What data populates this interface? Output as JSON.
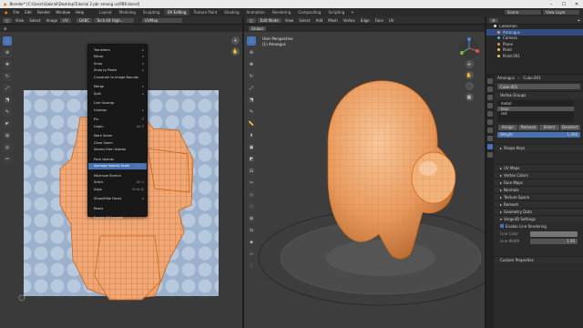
{
  "window": {
    "title": "Blender* [C:\\Users\\Gabriel\\Desktop\\Tutorial 2 pbr among us\\PBR.blend]",
    "controls": [
      "–",
      "☐",
      "✕"
    ]
  },
  "menubar": {
    "menus": [
      "File",
      "Edit",
      "Render",
      "Window",
      "Help"
    ],
    "workspaces": [
      "Layout",
      "Modeling",
      "Sculpting",
      "UV Editing",
      "Texture Paint",
      "Shading",
      "Animation",
      "Rendering",
      "Compositing",
      "Scripting"
    ],
    "active_workspace": "UV Editing",
    "scene": "Scene",
    "view_layer": "View Layer"
  },
  "uv_editor": {
    "header_items": [
      "View",
      "Select",
      "Image",
      "UV"
    ],
    "sync_label": "GABC",
    "image_name": "Tech.04 High...",
    "uvmap": "UVMap"
  },
  "uv_menu": {
    "items": [
      {
        "label": "Transform",
        "shortcut": "▸"
      },
      {
        "label": "Mirror",
        "shortcut": "▸"
      },
      {
        "label": "Snap",
        "shortcut": "▸"
      },
      {
        "label": "Snap to Pixels",
        "shortcut": "▸"
      },
      {
        "label": "Constrain to Image Bounds",
        "shortcut": ""
      },
      {
        "sep": true
      },
      {
        "label": "Merge",
        "shortcut": "▸"
      },
      {
        "label": "Split",
        "shortcut": "▸"
      },
      {
        "sep": true
      },
      {
        "label": "Live Unwrap",
        "shortcut": ""
      },
      {
        "label": "Unwrap",
        "shortcut": "▸"
      },
      {
        "sep": true
      },
      {
        "label": "Pin",
        "shortcut": "P"
      },
      {
        "label": "Unpin",
        "shortcut": "Alt P"
      },
      {
        "sep": true
      },
      {
        "label": "Mark Seam",
        "shortcut": ""
      },
      {
        "label": "Clear Seam",
        "shortcut": ""
      },
      {
        "label": "Seams from Islands",
        "shortcut": ""
      },
      {
        "sep": true
      },
      {
        "label": "Pack Islands",
        "shortcut": ""
      },
      {
        "label": "Average Islands Scale",
        "shortcut": "Ctrl A",
        "highlight": true
      },
      {
        "sep": true
      },
      {
        "label": "Minimize Stretch",
        "shortcut": ""
      },
      {
        "label": "Stitch",
        "shortcut": "Alt V"
      },
      {
        "label": "Align",
        "shortcut": "Shift W"
      },
      {
        "sep": true
      },
      {
        "label": "Show/Hide Faces",
        "shortcut": "▸"
      },
      {
        "sep": true
      },
      {
        "label": "Reset",
        "shortcut": ""
      },
      {
        "sep": true
      },
      {
        "label": "Export UV Layout",
        "shortcut": ""
      }
    ]
  },
  "viewport": {
    "mode": "Edit Mode",
    "header_items": [
      "View",
      "Select",
      "Add",
      "Mesh",
      "Vertex",
      "Edge",
      "Face",
      "UV"
    ],
    "orientation": "Global",
    "overlay_title": "User Perspective",
    "overlay_object": "(1) Amongus"
  },
  "outliner": {
    "title": "Scene Collection",
    "rows": [
      {
        "label": "Collection",
        "color": "#dddddd",
        "selected": false
      },
      {
        "label": "Amongus",
        "color": "#e69a3c",
        "selected": true
      },
      {
        "label": "Camera",
        "color": "#5ab4d6",
        "selected": false
      },
      {
        "label": "Plane",
        "color": "#e69a3c",
        "selected": false
      },
      {
        "label": "Point",
        "color": "#e8d05c",
        "selected": false
      },
      {
        "label": "Point.001",
        "color": "#e8d05c",
        "selected": false
      }
    ]
  },
  "properties": {
    "object_name": "Amongus",
    "mesh_name": "Cube.001",
    "vertex_groups_title": "Vertex Groups",
    "vertex_groups": [
      "metal",
      "blue",
      "red"
    ],
    "selected_group": "blue",
    "vg_buttons": [
      "Assign",
      "Remove",
      "Select",
      "Deselect"
    ],
    "weight_label": "Weight",
    "weight_value": "1.000",
    "sections": [
      "Shape Keys",
      "UV Maps",
      "Vertex Colors",
      "Face Maps",
      "Normals",
      "Texture Space",
      "Remesh",
      "Geometry Data",
      "Verge3D Settings"
    ],
    "enable_label": "Enable Line Rendering",
    "line_color_label": "Line Color",
    "line_width_label": "Line Width",
    "line_width_value": "1.00",
    "custom_props": "Custom Properties"
  },
  "colors": {
    "accent": "#4772b3",
    "mesh": "#f0a05a",
    "mesh_edge": "#c86414",
    "uv_bg_circle": "#b4c6dc",
    "uv_bg": "#9cb2cc"
  }
}
